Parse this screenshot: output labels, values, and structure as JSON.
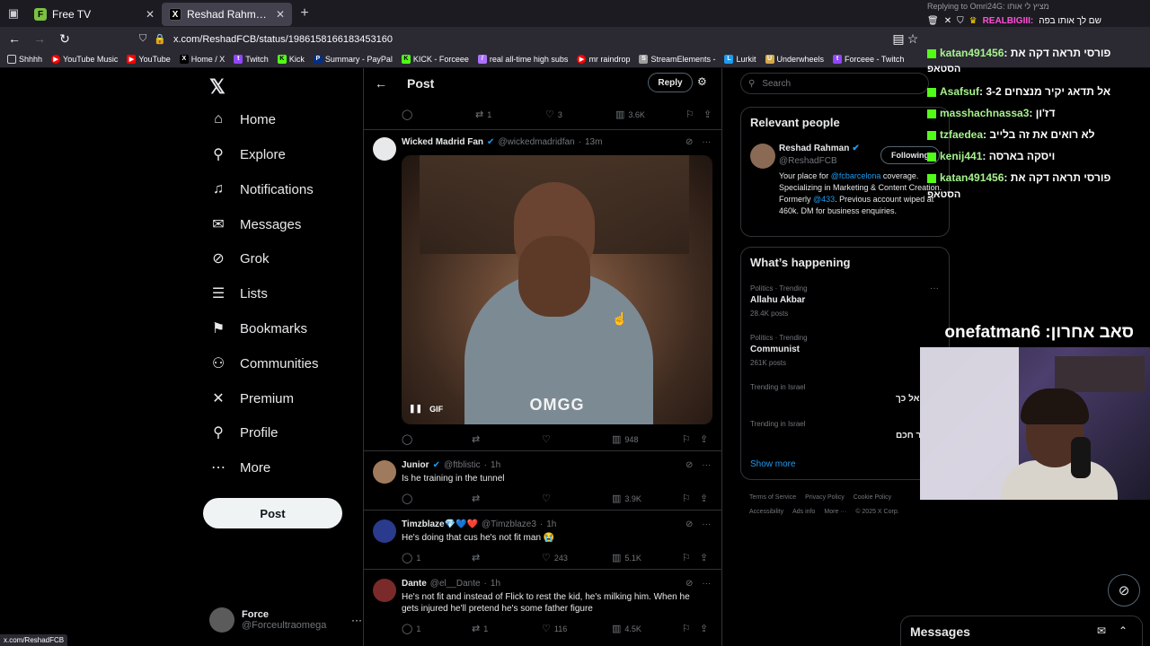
{
  "browser": {
    "tabs": [
      {
        "label": "Free TV",
        "favicon": "F",
        "favicon_color": "#7cc142"
      },
      {
        "label": "Reshad Rahman on X: \"https://",
        "favicon": "X",
        "favicon_color": "#000000"
      }
    ],
    "url": "x.com/ReshadFCB/status/1986158166183453160",
    "bookmarks": [
      {
        "label": "Shhhh",
        "icon": "folder-icon",
        "color": "#cfcfd8"
      },
      {
        "label": "YouTube Music",
        "icon": "youtube-music-icon",
        "color": "#ff0000"
      },
      {
        "label": "YouTube",
        "icon": "youtube-icon",
        "color": "#ff0000"
      },
      {
        "label": "Home / X",
        "icon": "x-icon",
        "color": "#000000"
      },
      {
        "label": "Twitch",
        "icon": "twitch-icon",
        "color": "#9146ff"
      },
      {
        "label": "Kick",
        "icon": "kick-icon",
        "color": "#53fc18"
      },
      {
        "label": "Summary - PayPal",
        "icon": "paypal-icon",
        "color": "#003087"
      },
      {
        "label": "KICK - Forceee",
        "icon": "kick-icon",
        "color": "#53fc18"
      },
      {
        "label": "real all-time high subs",
        "icon": "link-icon",
        "color": "#ab71ff"
      },
      {
        "label": "mr raindrop",
        "icon": "youtube-icon",
        "color": "#ff0000"
      },
      {
        "label": "StreamElements -",
        "icon": "streamelements-icon",
        "color": "#9e9e9e"
      },
      {
        "label": "Lurkit",
        "icon": "lurkit-icon",
        "color": "#1d9bf0"
      },
      {
        "label": "Underwheels",
        "icon": "underwheels-icon",
        "color": "#d4a94b"
      },
      {
        "label": "Forceee - Twitch",
        "icon": "twitch-icon",
        "color": "#9146ff"
      }
    ],
    "status_url": "x.com/ReshadFCB"
  },
  "sidebar": {
    "items": [
      {
        "label": "Home",
        "icon": "home-icon",
        "glyph": "⌂"
      },
      {
        "label": "Explore",
        "icon": "search-icon",
        "glyph": "⚲"
      },
      {
        "label": "Notifications",
        "icon": "bell-icon",
        "glyph": "🔔"
      },
      {
        "label": "Messages",
        "icon": "envelope-icon",
        "glyph": "✉"
      },
      {
        "label": "Grok",
        "icon": "grok-icon",
        "glyph": "⊘"
      },
      {
        "label": "Lists",
        "icon": "lists-icon",
        "glyph": "☰"
      },
      {
        "label": "Bookmarks",
        "icon": "bookmark-icon",
        "glyph": "⚑"
      },
      {
        "label": "Communities",
        "icon": "communities-icon",
        "glyph": "👥"
      },
      {
        "label": "Premium",
        "icon": "x-premium-icon",
        "glyph": "𝕏"
      },
      {
        "label": "Profile",
        "icon": "profile-icon",
        "glyph": "👤"
      },
      {
        "label": "More",
        "icon": "more-circle-icon",
        "glyph": "⋯"
      }
    ],
    "post_label": "Post",
    "account": {
      "name": "Force",
      "handle": "@Forceultraomega"
    }
  },
  "center": {
    "title": "Post",
    "reply_label": "Reply",
    "top_actions": {
      "reposts": "1",
      "likes": "3",
      "views": "3.6K"
    },
    "tweets": [
      {
        "name": "Wicked Madrid Fan",
        "handle": "@wickedmadridfan",
        "time": "13m",
        "verified": true,
        "text": "",
        "gif_caption": "OMGG",
        "gif_label": "GIF",
        "replies": "",
        "reposts": "",
        "likes": "",
        "views": "948"
      },
      {
        "name": "Junior",
        "handle": "@ftblistic",
        "time": "1h",
        "verified": true,
        "text": "Is he training in the tunnel",
        "replies": "",
        "reposts": "",
        "likes": "",
        "views": "3.9K"
      },
      {
        "name": "Timzblaze💎💙❤️",
        "handle": "@Timzblaze3",
        "time": "1h",
        "verified": false,
        "text": "He's doing that cus he's not fit man 😭",
        "replies": "1",
        "reposts": "",
        "likes": "243",
        "views": "5.1K"
      },
      {
        "name": "Dante",
        "handle": "@el__Dante",
        "time": "1h",
        "verified": false,
        "text": "He's not fit and instead of Flick to rest the kid, he's milking him. When he gets injured he'll pretend he's some father figure",
        "replies": "1",
        "reposts": "1",
        "likes": "116",
        "views": "4.5K"
      }
    ]
  },
  "right": {
    "search_placeholder": "Search",
    "relevant_title": "Relevant people",
    "relevant": {
      "name": "Reshad Rahman",
      "handle": "@ReshadFCB",
      "follow_label": "Following",
      "bio_1": "Your place for ",
      "bio_link1": "@fcbarcelona",
      "bio_2": " coverage. Specializing in Marketing & Content Creation. Formerly ",
      "bio_link2": "@433",
      "bio_3": ". Previous account wiped at 460k. DM for business enquiries."
    },
    "happening_title": "What’s happening",
    "trends": [
      {
        "meta": "Politics · Trending",
        "name": "Allahu Akbar",
        "count": "28.4K posts"
      },
      {
        "meta": "Politics · Trending",
        "name": "Communist",
        "count": "261K posts"
      },
      {
        "meta": "Trending in Israel",
        "name": "",
        "count": ""
      },
      {
        "meta": "Trending in Israel",
        "name": "",
        "count": ""
      }
    ],
    "show_more": "Show more",
    "footer": [
      "Terms of Service",
      "Privacy Policy",
      "Cookie Policy",
      "Accessibility",
      "Ads info",
      "More ···",
      "© 2025 X Corp."
    ]
  },
  "overlay": {
    "reply_to": "Replying to Omri24G: מציץ לי אותו",
    "top_line_user": "REALBIGIII:",
    "top_line_text": "שם לך אותו בפה",
    "chat": [
      {
        "user": "katan491456",
        "text": ": פורסי תראה דקה את"
      },
      {
        "user": "Asafsuf",
        "text": ": אל תדאג יקיר מנצחים 3-2"
      },
      {
        "user": "masshachnassa3",
        "text": ": דז'ון"
      },
      {
        "user": "tzfaedea",
        "text": ": לא רואים את זה בלייב"
      },
      {
        "user": "kenij441",
        "text": ": ויסקה בארסה"
      },
      {
        "user": "katan491456",
        "text": ": פורסי תראה דקה את"
      }
    ],
    "chat_cont_1": "הסטאפ",
    "chat_cont_2": "הסטאפ",
    "banner": "onefatman6 :סאב אחרון",
    "trend_text_3": "אל כך",
    "trend_text_4": "ר חכם"
  },
  "messages_drawer": {
    "title": "Messages"
  }
}
